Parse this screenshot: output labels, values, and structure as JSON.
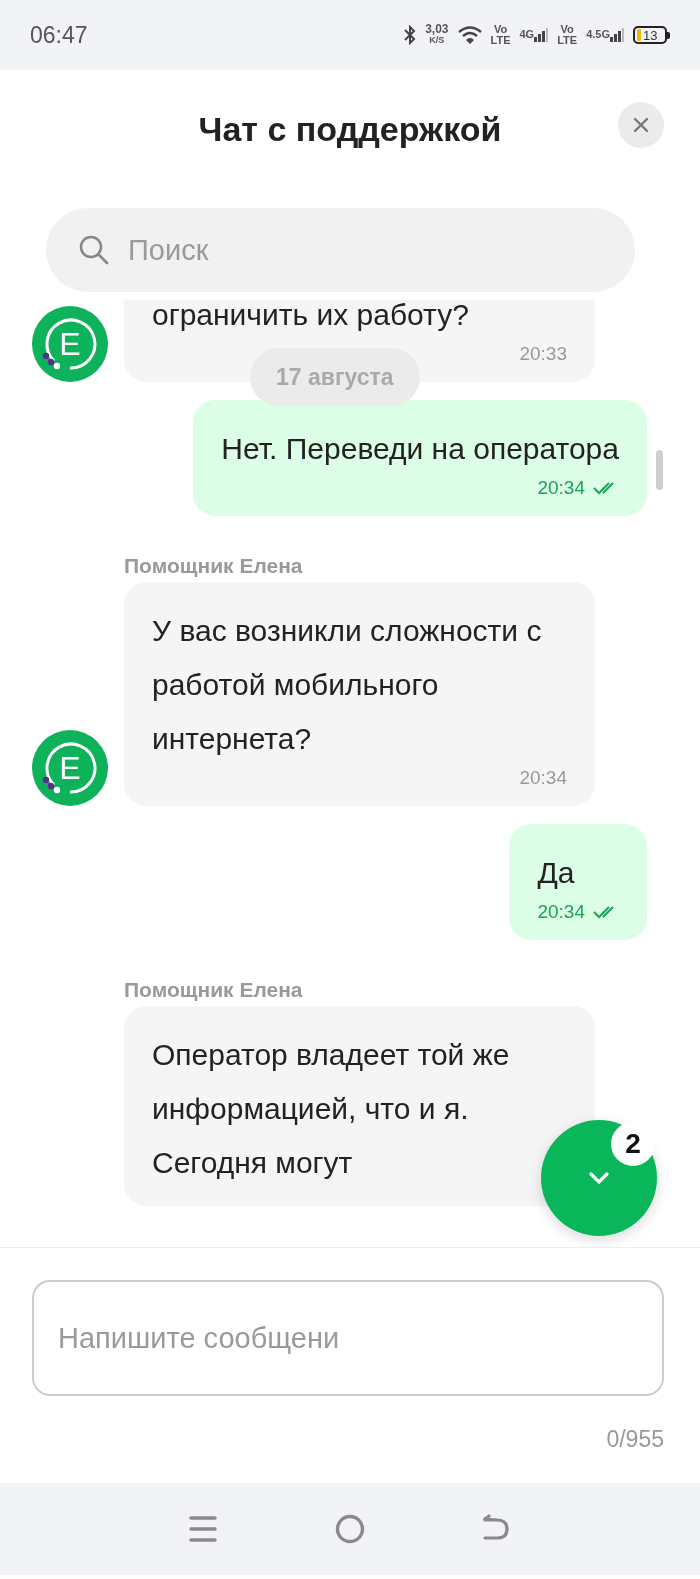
{
  "status_bar": {
    "time": "06:47",
    "net_speed": "3,03",
    "net_unit": "K/S",
    "sims": [
      {
        "volte_top": "Vo",
        "volte_bottom": "LTE",
        "network": "4G"
      },
      {
        "volte_top": "Vo",
        "volte_bottom": "LTE",
        "network": "4.5G"
      }
    ],
    "battery": "13"
  },
  "header": {
    "title": "Чат с поддержкой"
  },
  "search": {
    "placeholder": "Поиск"
  },
  "messages": [
    {
      "kind": "incoming",
      "text": "ограничить их работу?",
      "time": "20:33",
      "avatar": "Е"
    },
    {
      "kind": "date",
      "text": "17 августа"
    },
    {
      "kind": "outgoing",
      "text": "Нет. Переведи на оператора",
      "time": "20:34",
      "read": true
    },
    {
      "kind": "incoming",
      "sender": "Помощник Елена",
      "text": "У вас возникли сложности с работой мобильного интернета?",
      "time": "20:34",
      "avatar": "Е"
    },
    {
      "kind": "outgoing",
      "text": "Да",
      "time": "20:34",
      "read": true
    },
    {
      "kind": "incoming",
      "sender": "Помощник Елена",
      "text": "Оператор владеет той же информацией, что и я. Сегодня могут"
    }
  ],
  "scroll_button": {
    "badge": "2"
  },
  "composer": {
    "placeholder": "Напишите сообщени",
    "counter": "0/955"
  }
}
